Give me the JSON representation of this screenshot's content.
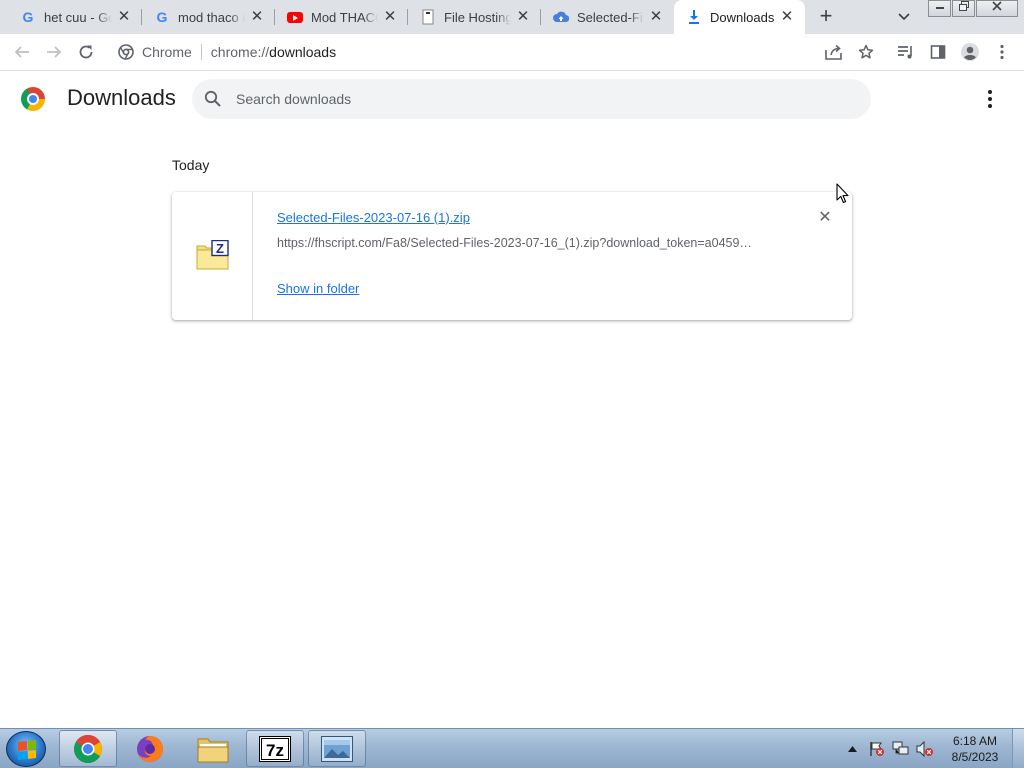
{
  "tabs": [
    {
      "title": "het cuu - Google Search",
      "favicon": "google-icon",
      "active": false
    },
    {
      "title": "mod thaco mdm - Google Search",
      "favicon": "google-icon",
      "active": false
    },
    {
      "title": "Mod THACO",
      "favicon": "youtube-icon",
      "active": false
    },
    {
      "title": "File Hosting",
      "favicon": "file-hosting-icon",
      "active": false
    },
    {
      "title": "Selected-Files",
      "favicon": "cloud-icon",
      "active": false
    },
    {
      "title": "Downloads",
      "favicon": "download-icon",
      "active": true
    }
  ],
  "omnibox": {
    "chip": "Chrome",
    "scheme": "chrome://",
    "host": "downloads"
  },
  "page": {
    "title": "Downloads",
    "search_placeholder": "Search downloads"
  },
  "downloads": {
    "date_header": "Today",
    "items": [
      {
        "file_name": "Selected-Files-2023-07-16 (1).zip",
        "url": "https://fhscript.com/Fa8/Selected-Files-2023-07-16_(1).zip?download_token=a0459…",
        "action": "Show in folder",
        "icon": "zip-file-icon"
      }
    ]
  },
  "taskbar": {
    "clock_time": "6:18 AM",
    "clock_date": "8/5/2023"
  },
  "colors": {
    "link": "#1a73e8",
    "tabstrip": "#dee1e6",
    "searchbar": "#f1f3f4"
  }
}
